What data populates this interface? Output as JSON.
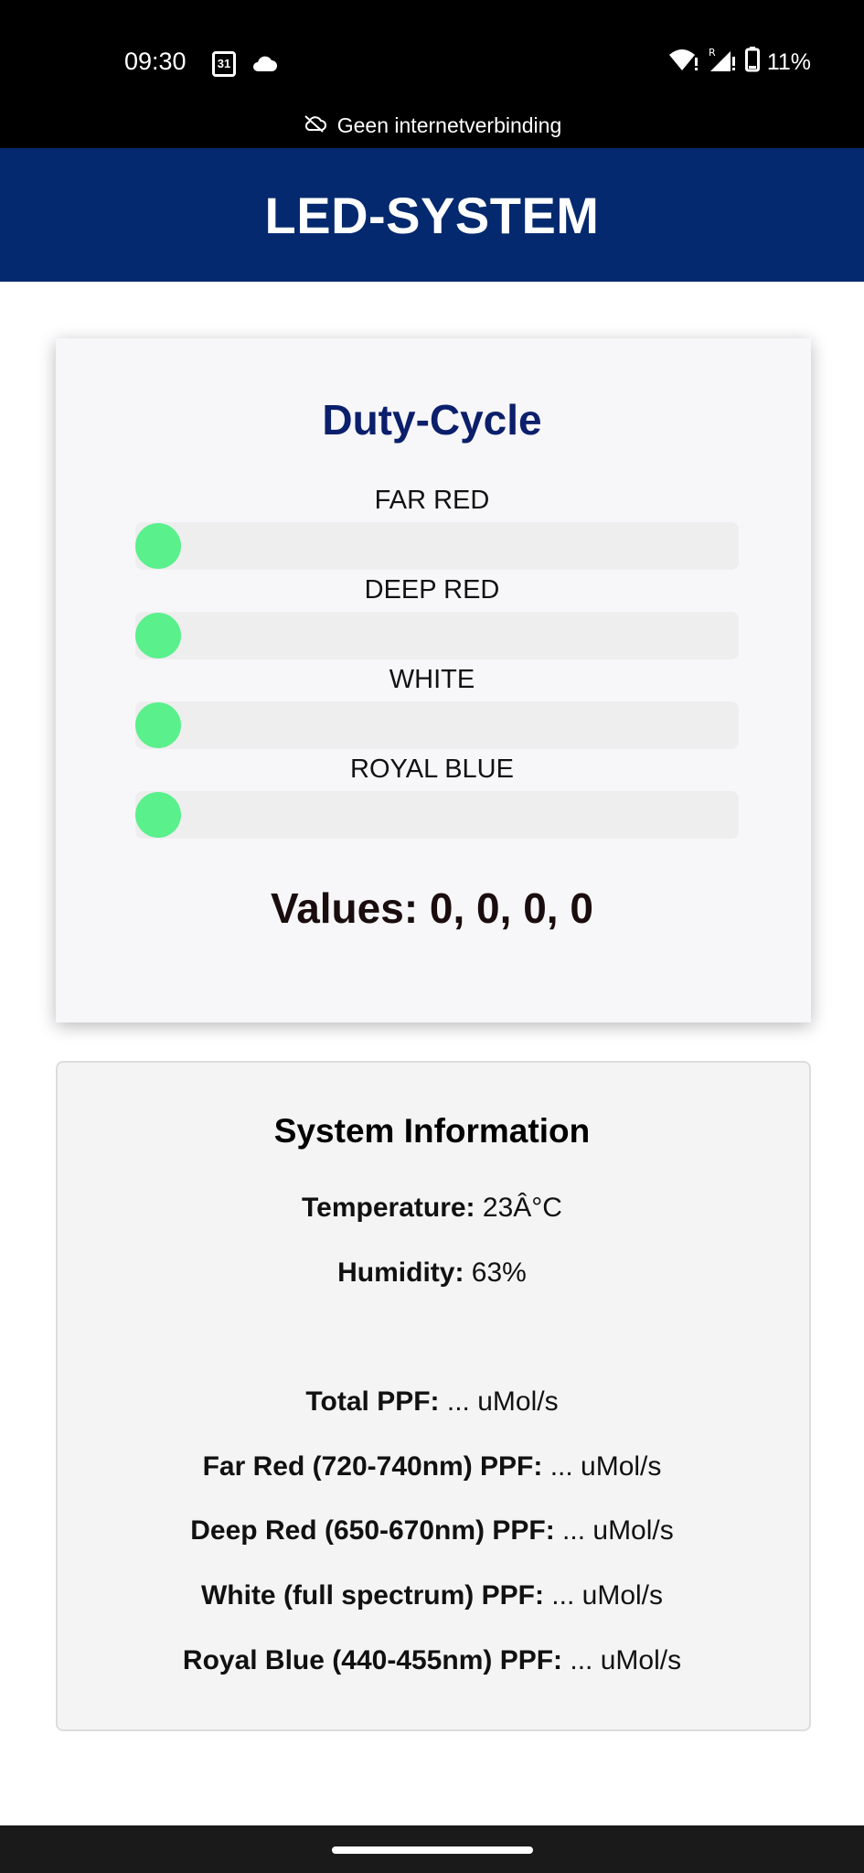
{
  "status_bar": {
    "time": "09:30",
    "calendar_day": "31",
    "battery": "11%",
    "network_banner": "Geen internetverbinding"
  },
  "header": {
    "title": "LED-SYSTEM"
  },
  "duty_cycle": {
    "title": "Duty-Cycle",
    "sliders": [
      {
        "label": "FAR RED",
        "value": 0
      },
      {
        "label": "DEEP RED",
        "value": 0
      },
      {
        "label": "WHITE",
        "value": 0
      },
      {
        "label": "ROYAL BLUE",
        "value": 0
      }
    ],
    "values_text": "Values: 0, 0, 0, 0",
    "thumb_color": "#5af08c"
  },
  "system_info": {
    "title": "System Information",
    "temperature": {
      "label": "Temperature:",
      "value": " 23Â°C"
    },
    "humidity": {
      "label": "Humidity:",
      "value": " 63%"
    },
    "total_ppf": {
      "label": "Total PPF:",
      "value": " ... uMol/s"
    },
    "far_red_ppf": {
      "label": "Far Red (720-740nm) PPF:",
      "value": " ... uMol/s"
    },
    "deep_red_ppf": {
      "label": "Deep Red (650-670nm) PPF:",
      "value": " ... uMol/s"
    },
    "white_ppf": {
      "label": "White (full spectrum) PPF:",
      "value": " ... uMol/s"
    },
    "royal_blue_ppf": {
      "label": "Royal Blue (440-455nm) PPF:",
      "value": " ... uMol/s"
    }
  },
  "colors": {
    "header_bg": "#04296e",
    "duty_title": "#0b1f6b"
  }
}
